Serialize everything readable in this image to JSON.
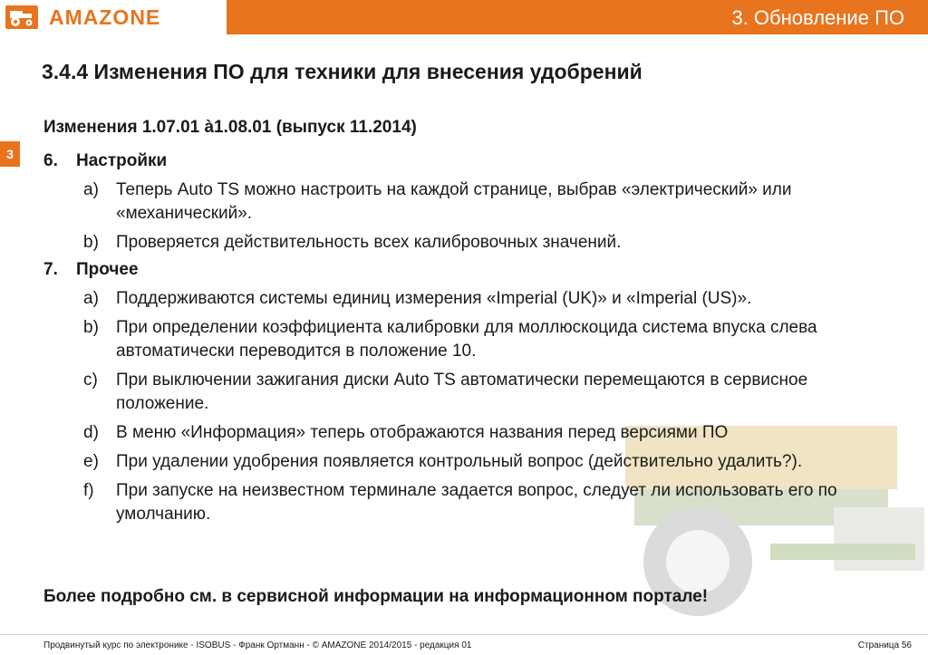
{
  "header": {
    "brand": "AMAZONE",
    "section_title": "3.  Обновление ПО"
  },
  "side_tab": "3",
  "title": "3.4.4 Изменения ПО для техники для внесения удобрений",
  "subtitle": "Изменения 1.07.01 à1.08.01 (выпуск 11.2014)",
  "sections": [
    {
      "number": "6.",
      "heading": "Настройки",
      "items": [
        {
          "letter": "a)",
          "text": "Теперь Auto TS можно настроить на каждой странице, выбрав «электрический» или «механический»."
        },
        {
          "letter": "b)",
          "text": "Проверяется действительность всех калибровочных значений."
        }
      ]
    },
    {
      "number": "7.",
      "heading": "Прочее",
      "items": [
        {
          "letter": "a)",
          "text": "Поддерживаются системы единиц измерения «Imperial (UK)» и «Imperial (US)»."
        },
        {
          "letter": "b)",
          "text": "При определении коэффициента калибровки для моллюскоцида система впуска слева автоматически переводится в положение 10."
        },
        {
          "letter": "c)",
          "text": "При выключении зажигания диски Auto TS автоматически перемещаются в сервисное положение."
        },
        {
          "letter": "d)",
          "text": "В меню «Информация» теперь отображаются названия перед версиями ПО"
        },
        {
          "letter": "e)",
          "text": "При удалении удобрения появляется контрольный вопрос (действительно удалить?)."
        },
        {
          "letter": "f)",
          "text": "При запуске на неизвестном терминале задается вопрос, следует ли использовать его по умолчанию."
        }
      ]
    }
  ],
  "bottom_note": "Более подробно см. в сервисной информации на информационном портале!",
  "footer": {
    "left": "Продвинутый курс по электронике - ISOBUS - Франк Ортманн - © AMAZONE 2014/2015 - редакция 01",
    "right": "Страница 56"
  },
  "colors": {
    "accent": "#e8741e"
  },
  "icons": {
    "logo": "tractor-emblem-icon"
  }
}
